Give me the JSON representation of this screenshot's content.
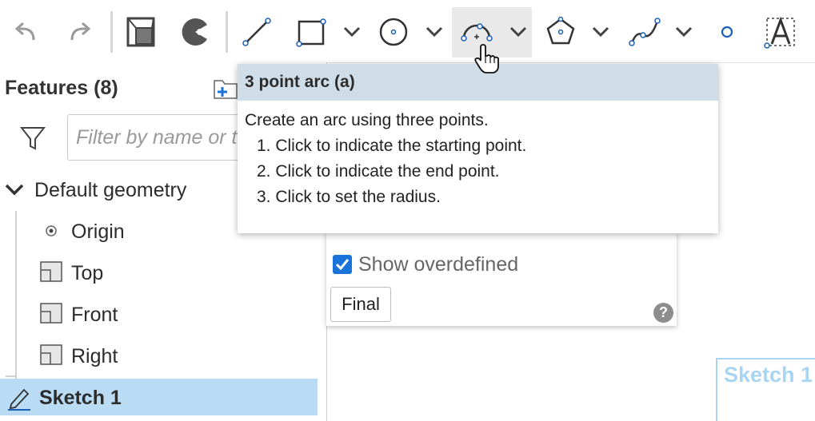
{
  "toolbar": {
    "tools": [
      {
        "name": "undo-icon"
      },
      {
        "name": "redo-icon"
      },
      {
        "name": "use-icon"
      },
      {
        "name": "pie-icon"
      },
      {
        "name": "line-icon"
      },
      {
        "name": "rectangle-icon"
      },
      {
        "name": "circle-icon"
      },
      {
        "name": "three-point-arc-icon"
      },
      {
        "name": "polygon-icon"
      },
      {
        "name": "spline-icon"
      },
      {
        "name": "point-icon"
      },
      {
        "name": "text-icon"
      }
    ],
    "active_tool": "three-point-arc-icon",
    "accent_color": "#1a5fb4"
  },
  "features": {
    "title": "Features (8)",
    "filter_placeholder": "Filter by name or t",
    "group_label": "Default geometry",
    "items": [
      {
        "label": "Origin",
        "icon": "origin-icon"
      },
      {
        "label": "Top",
        "icon": "plane-icon"
      },
      {
        "label": "Front",
        "icon": "plane-icon"
      },
      {
        "label": "Right",
        "icon": "plane-icon"
      }
    ],
    "selected_item": {
      "label": "Sketch 1",
      "icon": "pencil-icon"
    },
    "selection_color": "#b9dcf4"
  },
  "sketch_panel": {
    "show_overdefined_label": "Show overdefined",
    "show_overdefined_checked": true,
    "final_label": "Final",
    "help_glyph": "?"
  },
  "tooltip": {
    "title": "3 point arc (a)",
    "description": "Create an arc using three points.",
    "steps": [
      "1. Click to indicate the starting point.",
      "2. Click to indicate the end point.",
      "3. Click to set the radius."
    ],
    "header_color": "#cfdde9"
  },
  "canvas": {
    "sketch_label": "Sketch 1"
  }
}
